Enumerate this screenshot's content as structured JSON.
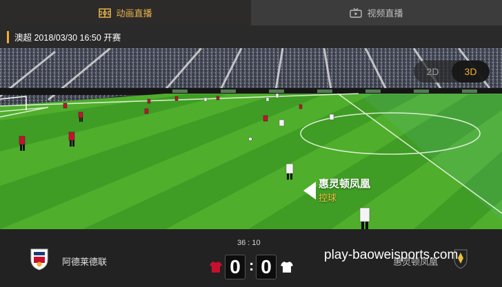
{
  "tabs": {
    "animation": {
      "label": "动画直播",
      "icon": "pitch-icon"
    },
    "video": {
      "label": "视频直播",
      "icon": "tv-icon"
    }
  },
  "match_info": {
    "text": "澳超 2018/03/30 16:50 开赛"
  },
  "view_toggle": {
    "option_2d": "2D",
    "option_3d": "3D",
    "selected": "3D"
  },
  "event": {
    "team": "惠灵顿凤凰",
    "state": "控球"
  },
  "scoreboard": {
    "clock": "36 : 10",
    "home": {
      "name": "阿德莱德联",
      "score": "0",
      "jersey_color": "#c8102e"
    },
    "away": {
      "name": "惠灵顿凤凰",
      "score": "0",
      "jersey_color": "#ffffff"
    },
    "separator": ":"
  },
  "watermark": "play-baoweisports.com",
  "colors": {
    "accent": "#f0b12f",
    "pitch_light": "#4fae2c",
    "pitch_dark": "#3c9722"
  }
}
